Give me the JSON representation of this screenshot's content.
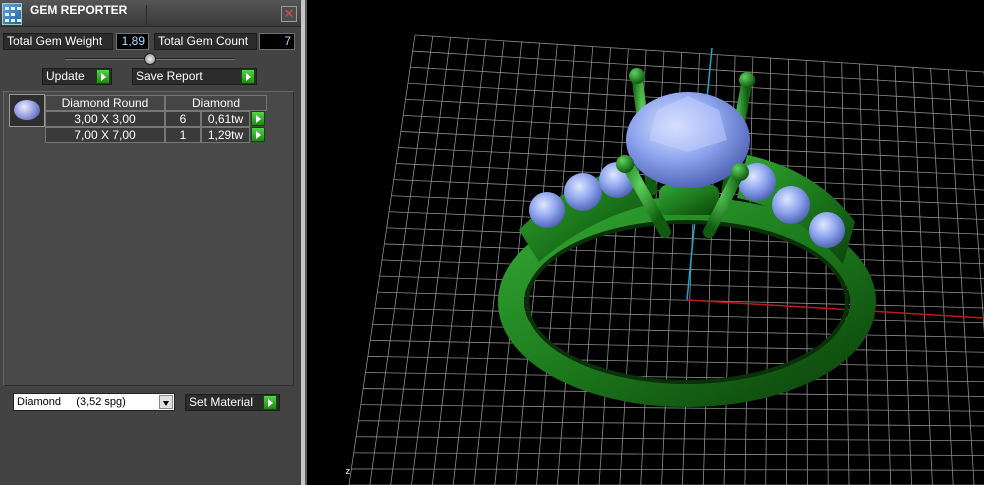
{
  "window": {
    "title": "GEM REPORTER",
    "close_symbol": "✕",
    "icon": "gem-reporter-app-icon"
  },
  "stats": {
    "total_weight_label": "Total Gem Weight",
    "total_weight_value": "1,89",
    "total_count_label": "Total Gem Count",
    "total_count_value": "7"
  },
  "buttons": {
    "update": "Update",
    "save_report": "Save Report",
    "set_material": "Set Material"
  },
  "gem_table": {
    "thumbnail": "round-diamond-thumbnail",
    "columns": [
      "Diamond Round",
      "Diamond"
    ],
    "rows": [
      {
        "size": "3,00 X 3,00",
        "count": "6",
        "weight": "0,61tw"
      },
      {
        "size": "7,00 X 7,00",
        "count": "1",
        "weight": "1,29tw"
      }
    ]
  },
  "material_select": {
    "value": "Diamond     (3,52 spg)"
  },
  "viewport": {
    "axis_label": "z",
    "colors": {
      "grid": "#8c8c8c",
      "ring_metal": "#1c7a1c",
      "stones": "#8fa6ef",
      "axis_x": "#c01818",
      "axis_y": "#1aa8c8"
    }
  }
}
